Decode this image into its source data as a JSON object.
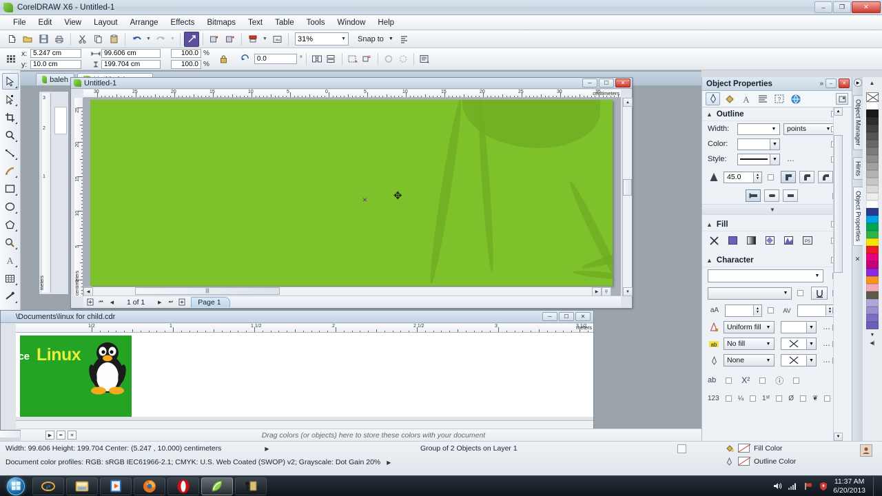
{
  "window": {
    "title": "CorelDRAW X6 - Untitled-1",
    "app_icon": "coreldraw-logo-icon",
    "min_label": "–",
    "restore_label": "❐",
    "close_label": "✕"
  },
  "menu": {
    "items": [
      "File",
      "Edit",
      "View",
      "Layout",
      "Arrange",
      "Effects",
      "Bitmaps",
      "Text",
      "Table",
      "Tools",
      "Window",
      "Help"
    ]
  },
  "standard_toolbar": {
    "buttons": [
      {
        "name": "new-document-button",
        "glyph": "⬚",
        "label": "New"
      },
      {
        "name": "open-document-button",
        "glyph": "🗁",
        "label": "Open"
      },
      {
        "name": "save-button",
        "glyph": "💾",
        "label": "Save"
      },
      {
        "name": "print-button",
        "glyph": "⎙",
        "label": "Print"
      },
      {
        "name": "cut-button",
        "glyph": "✂",
        "label": "Cut"
      },
      {
        "name": "copy-button",
        "glyph": "⧉",
        "label": "Copy"
      },
      {
        "name": "paste-button",
        "glyph": "📋",
        "label": "Paste"
      },
      {
        "name": "undo-button",
        "glyph": "↶",
        "label": "Undo"
      },
      {
        "name": "redo-button",
        "glyph": "↷",
        "label": "Redo"
      },
      {
        "name": "import-button",
        "glyph": "⬋",
        "label": "Import"
      },
      {
        "name": "export-button",
        "glyph": "⬆",
        "label": "Export"
      },
      {
        "name": "publish-pdf-button",
        "glyph": "⤓",
        "label": "Publish to PDF"
      },
      {
        "name": "application-launcher-button",
        "glyph": "◱",
        "label": "Application launcher"
      }
    ],
    "zoom_level": "31%",
    "snap_to_label": "Snap to",
    "options_label": "Options"
  },
  "property_bar": {
    "object_origin_label": "object-origin-picker",
    "x_label": "x:",
    "x_value": "5.247 cm",
    "y_label": "y:",
    "y_value": "10.0 cm",
    "width_value": "99.606 cm",
    "height_value": "199.704 cm",
    "scale_h": "100.0",
    "scale_v": "100.0",
    "percent_symbol": "%",
    "lock_ratio_label": "lock-ratio-toggle",
    "rotation_value": "0.0",
    "degree_symbol": "°",
    "buttons": [
      {
        "name": "mirror-horizontal-button",
        "glyph": "⧉"
      },
      {
        "name": "mirror-vertical-button",
        "glyph": "⌸"
      },
      {
        "name": "convert-to-curves-button",
        "glyph": "⬚"
      },
      {
        "name": "wrap-text-button",
        "glyph": "⬚"
      },
      {
        "name": "outline-width-button",
        "glyph": "○"
      },
      {
        "name": "edit-outline-button",
        "glyph": "○"
      },
      {
        "name": "object-properties-button",
        "glyph": "◳"
      }
    ]
  },
  "toolbox": {
    "tools": [
      {
        "name": "pick-tool",
        "glyph": "➤",
        "selected": true
      },
      {
        "name": "shape-tool",
        "glyph": "✐",
        "selected": false
      },
      {
        "name": "crop-tool",
        "glyph": "✄",
        "selected": false
      },
      {
        "name": "zoom-tool",
        "glyph": "⌕",
        "selected": false
      },
      {
        "name": "freehand-tool",
        "glyph": "✒",
        "selected": false
      },
      {
        "name": "artistic-media-tool",
        "glyph": "🖌",
        "selected": false
      },
      {
        "name": "rectangle-tool",
        "glyph": "▭",
        "selected": false
      },
      {
        "name": "ellipse-tool",
        "glyph": "○",
        "selected": false
      },
      {
        "name": "polygon-tool",
        "glyph": "⬡",
        "selected": false
      },
      {
        "name": "basic-shapes-tool",
        "glyph": "◔",
        "selected": false
      },
      {
        "name": "text-tool",
        "glyph": "A",
        "selected": false
      },
      {
        "name": "table-tool",
        "glyph": "⊞",
        "selected": false
      },
      {
        "name": "parallel-dimension-tool",
        "glyph": "╱",
        "selected": false
      },
      {
        "name": "connector-tool",
        "glyph": "⤵",
        "selected": false
      },
      {
        "name": "blend-tool",
        "glyph": "⛃",
        "selected": false
      },
      {
        "name": "color-eyedropper-tool",
        "glyph": "✐",
        "selected": false
      },
      {
        "name": "outline-tool",
        "glyph": "✎",
        "selected": false
      },
      {
        "name": "fill-tool",
        "glyph": "◧",
        "selected": false
      },
      {
        "name": "interactive-fill-tool",
        "glyph": "◑",
        "selected": false
      }
    ]
  },
  "document_tabs": [
    {
      "name": "doc-tab-baleh",
      "label": "baleh",
      "active": false
    },
    {
      "name": "doc-tab-untitled-1",
      "label": "Untitled-1",
      "active": true
    }
  ],
  "child_window_1": {
    "title": "Untitled-1",
    "ruler_unit": "centimeters",
    "ruler_unit_v": "centimeters",
    "h_ticks": [
      "30",
      "25",
      "20",
      "15",
      "10",
      "5",
      "0",
      "5",
      "10",
      "15",
      "20",
      "25",
      "30",
      "35"
    ],
    "v_ticks": [
      "25",
      "20",
      "15",
      "10",
      "5",
      "0"
    ],
    "page_nav": {
      "add_page_start": "add-page-before",
      "first": "⏮",
      "prev": "◀",
      "counter": "1 of 1",
      "next": "▶",
      "last": "⏭",
      "add_page_end": "add-page-after",
      "page_tab": "Page 1"
    },
    "canvas": {
      "page_color": "#7dc22b",
      "blade_color": "#6fae22",
      "marker_x": "×",
      "cursor": "✥"
    }
  },
  "child_window_2": {
    "title": "\\Documents\\linux for child.cdr",
    "ruler_unit": "meters",
    "h_ticks": [
      "1/2",
      "1",
      "1 1/2",
      "2",
      "2 1/2",
      "3",
      "3 1/2"
    ],
    "artwork": {
      "bg_color": "#24a324",
      "text": "rce",
      "text_highlight": "Linux",
      "text_color": "#e8ef3a",
      "penguin": "tux-penguin-icon"
    }
  },
  "drag_strip": {
    "hint": "Drag colors (or objects) here to store these colors with your document"
  },
  "status_bar": {
    "dimensions": "Width: 99.606  Height: 199.704  Center: (5.247 , 10.000)  centimeters",
    "color_profiles": "Document color profiles: RGB: sRGB IEC61966-2.1; CMYK: U.S. Web Coated (SWOP) v2; Grayscale: Dot Gain 20%",
    "selection_info": "Group of 2 Objects on Layer 1",
    "fill_color_label": "Fill Color",
    "outline_color_label": "Outline Color",
    "arrow": "▶"
  },
  "docker": {
    "title": "Object Properties",
    "expand_glyph": "»",
    "min_glyph": "–",
    "close_glyph": "✕",
    "tabs": [
      {
        "name": "docker-tab-outline",
        "glyph": "✎",
        "selected": true
      },
      {
        "name": "docker-tab-fill",
        "glyph": "◧",
        "selected": false
      },
      {
        "name": "docker-tab-character",
        "glyph": "A",
        "selected": false
      },
      {
        "name": "docker-tab-paragraph",
        "glyph": "≡",
        "selected": false
      },
      {
        "name": "docker-tab-frame",
        "glyph": "⌸",
        "selected": false
      },
      {
        "name": "docker-tab-internet",
        "glyph": "🌐",
        "selected": false
      }
    ],
    "tab_end_glyph": "⬚",
    "outline": {
      "section_title": "Outline",
      "width_label": "Width:",
      "width_value": "",
      "width_units": "points",
      "color_label": "Color:",
      "style_label": "Style:",
      "dots": "…",
      "miter_value": "45.0",
      "corner_buttons": [
        "miter-corner",
        "bevel-corner",
        "round-corner"
      ],
      "cap_buttons": [
        "butt-cap",
        "round-cap",
        "square-cap"
      ],
      "expand_glyph": "▼"
    },
    "fill": {
      "section_title": "Fill",
      "types": [
        {
          "name": "fill-none-button",
          "glyph": "✕"
        },
        {
          "name": "fill-uniform-button",
          "glyph": "■"
        },
        {
          "name": "fill-fountain-button",
          "glyph": "▤"
        },
        {
          "name": "fill-pattern-button",
          "glyph": "✦"
        },
        {
          "name": "fill-texture-button",
          "glyph": "✤"
        },
        {
          "name": "fill-postscript-button",
          "glyph": "PS"
        }
      ]
    },
    "character": {
      "section_title": "Character",
      "font_value": "",
      "font_size_value": "",
      "style_value": "",
      "underline_glyph": "⎓",
      "size_icon": "aA",
      "range_kerning_icon": "AV",
      "fill_type": "Uniform fill",
      "background_fill_type": "No fill",
      "outline_type": "None",
      "dots": "…",
      "bottom_icons": [
        {
          "name": "character-position-button",
          "glyph": "ab"
        },
        {
          "name": "superscript-button",
          "glyph": "X²"
        },
        {
          "name": "character-effects-button",
          "glyph": "ⓘ"
        }
      ],
      "opentype_icons": [
        {
          "name": "opentype-numerals-button",
          "glyph": "123"
        },
        {
          "name": "opentype-fractions-button",
          "glyph": "¼"
        },
        {
          "name": "opentype-ordinals-button",
          "glyph": "1ˢᵗ"
        },
        {
          "name": "opentype-slashed-zero-button",
          "glyph": "Ø"
        },
        {
          "name": "opentype-swashes-button",
          "glyph": "❦"
        }
      ]
    }
  },
  "vertical_tabs": [
    {
      "name": "vtab-object-manager",
      "label": "Object Manager",
      "selected": false
    },
    {
      "name": "vtab-hints",
      "label": "Hints",
      "selected": false
    },
    {
      "name": "vtab-object-properties",
      "label": "Object Properties",
      "selected": true
    }
  ],
  "palette": {
    "no_color_label": "no-color-swatch",
    "colors": [
      "#ffffff",
      "#1a1a1a",
      "#2e2e2e",
      "#414141",
      "#555555",
      "#686868",
      "#7b7b7b",
      "#8e8e8e",
      "#a1a1a1",
      "#b4b4b4",
      "#c7c7c7",
      "#dadada",
      "#ededed",
      "#ffffff",
      "#2a3b8f",
      "#00a0e3",
      "#00a650",
      "#2eb34a",
      "#f5e400",
      "#ed1c24",
      "#e6007e",
      "#c5007c",
      "#8a2be2",
      "#f7941e",
      "#f4a7b9",
      "#5c5c4a",
      "#b0a8d8",
      "#9a8fd0",
      "#7b6fc4",
      "#6a5fb8"
    ]
  },
  "taskbar": {
    "start_label": "start-orb",
    "items": [
      {
        "name": "taskbar-internet-explorer",
        "glyph": "e"
      },
      {
        "name": "taskbar-windows-explorer",
        "glyph": "🗂"
      },
      {
        "name": "taskbar-media-player",
        "glyph": "▶"
      },
      {
        "name": "taskbar-firefox",
        "glyph": "◉"
      },
      {
        "name": "taskbar-opera",
        "glyph": "O"
      },
      {
        "name": "taskbar-coreldraw",
        "glyph": "⬚",
        "active": true
      },
      {
        "name": "taskbar-other-app",
        "glyph": "⚑"
      }
    ],
    "tray": [
      {
        "name": "tray-security-icon",
        "glyph": "⛊"
      },
      {
        "name": "tray-flag-icon",
        "glyph": "⚑"
      },
      {
        "name": "tray-network-icon",
        "glyph": "▆"
      },
      {
        "name": "tray-volume-icon",
        "glyph": "🔊"
      }
    ],
    "time": "11:37 AM",
    "date": "6/20/2013"
  }
}
